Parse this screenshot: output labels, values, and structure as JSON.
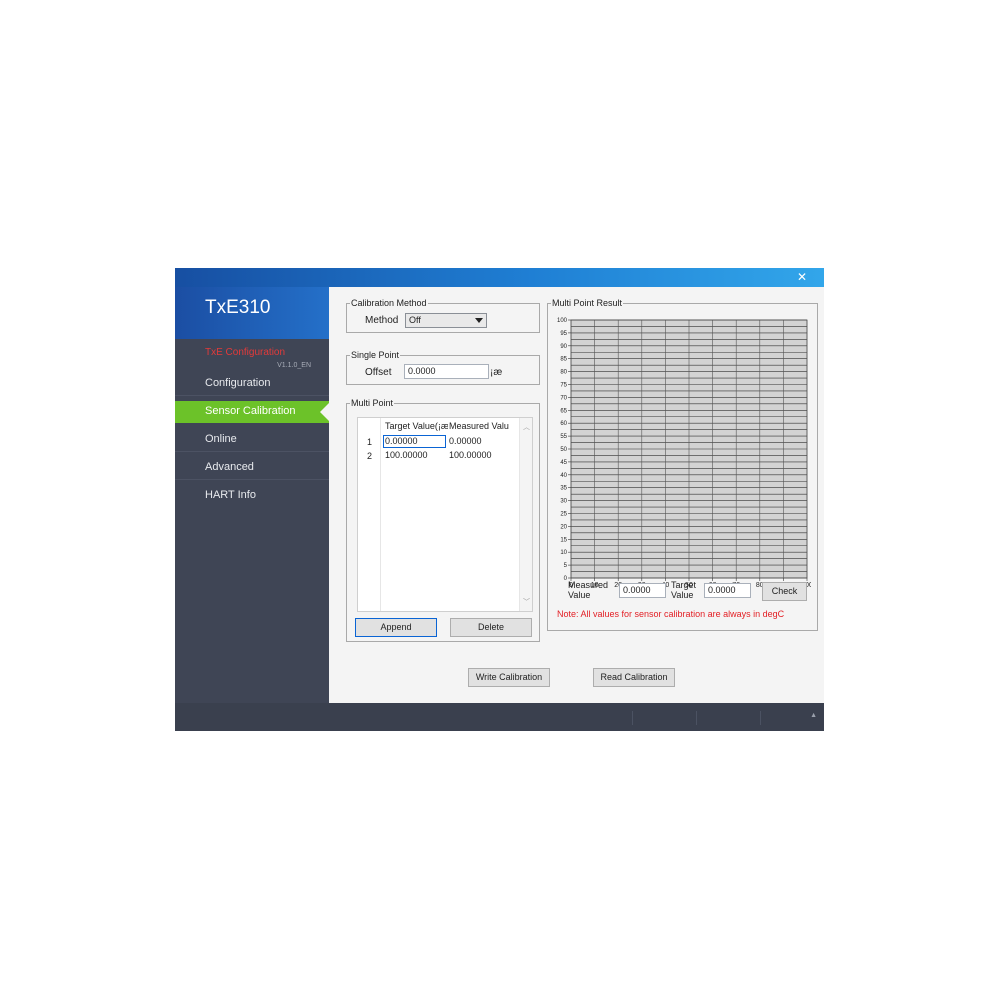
{
  "window": {
    "close_icon": "close-icon"
  },
  "sidebar": {
    "title": "TxE310",
    "section": "TxE Configuration",
    "version": "V1.1.0_EN",
    "items": [
      {
        "label": "Configuration"
      },
      {
        "label": "Sensor Calibration"
      },
      {
        "label": "Online"
      },
      {
        "label": "Advanced"
      },
      {
        "label": "HART Info"
      }
    ],
    "progress": 1.0,
    "colors": {
      "active": "#6cc229",
      "section": "#e23a3a"
    }
  },
  "calibration_method": {
    "legend": "Calibration Method",
    "method_label": "Method",
    "method_value": "Off"
  },
  "single_point": {
    "legend": "Single Point",
    "offset_label": "Offset",
    "offset_value": "0.0000",
    "unit": "¡æ"
  },
  "multi_point": {
    "legend": "Multi Point",
    "columns": [
      "Target Value(¡æ",
      "Measured Valu"
    ],
    "rows": [
      {
        "index": "1",
        "target": "0.00000",
        "measured": "0.00000"
      },
      {
        "index": "2",
        "target": "100.00000",
        "measured": "100.00000"
      }
    ],
    "append_label": "Append",
    "delete_label": "Delete"
  },
  "multi_point_result": {
    "legend": "Multi Point Result",
    "measured_label_1": "Measured",
    "measured_label_2": "Value",
    "measured_value": "0.0000",
    "target_label_1": "Target",
    "target_label_2": "Value",
    "target_value": "0.0000",
    "check_label": "Check",
    "note": "Note: All values for sensor calibration are always in degC"
  },
  "chart_data": {
    "type": "line",
    "title": "",
    "xlabel": "",
    "ylabel": "",
    "xlim": [
      0,
      100
    ],
    "ylim": [
      0,
      100
    ],
    "x_ticks": [
      0,
      10,
      20,
      30,
      40,
      50,
      60,
      70,
      80,
      90,
      100
    ],
    "y_ticks": [
      0,
      5,
      10,
      15,
      20,
      25,
      30,
      35,
      40,
      45,
      50,
      55,
      60,
      65,
      70,
      75,
      80,
      85,
      90,
      95,
      100
    ],
    "grid": true,
    "series": []
  },
  "actions": {
    "write_label": "Write Calibration",
    "read_label": "Read Calibration"
  }
}
